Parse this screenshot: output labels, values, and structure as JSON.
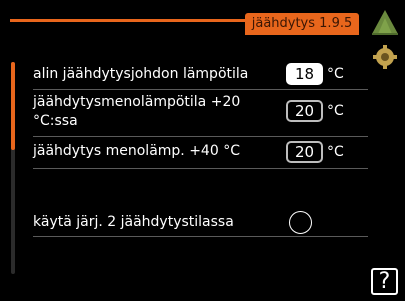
{
  "header": {
    "title": "jäähdytys 1.9.5"
  },
  "icons": {
    "home": "home-icon",
    "settings": "gear-icon",
    "help": "question-mark-icon"
  },
  "rows": [
    {
      "label": "alin jäähdytysjohdon lämpötila",
      "value": "18",
      "unit": "°C",
      "selected": true
    },
    {
      "label_line1": "jäähdytysmenolämpötila +20",
      "label_line2": "°C:ssa",
      "value": "20",
      "unit": "°C"
    },
    {
      "label": "jäähdytys menolämp. +40 °C",
      "value": "20",
      "unit": "°C"
    }
  ],
  "toggle": {
    "label": "käytä järj. 2 jäähdytystilassa",
    "checked": false
  },
  "help": {
    "label": "?"
  },
  "colors": {
    "accent": "#e8661c",
    "background": "#000000",
    "text": "#ffffff"
  }
}
